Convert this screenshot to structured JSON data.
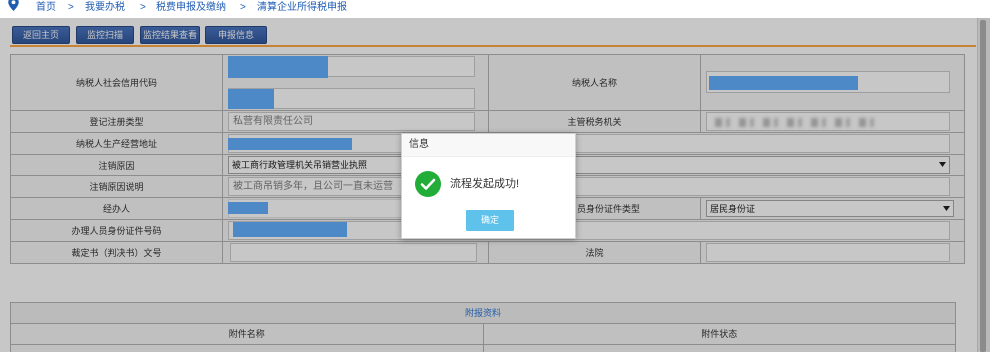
{
  "breadcrumb": {
    "separator": ">",
    "items": [
      "首页",
      "我要办税",
      "税费申报及缴纳",
      "清算企业所得税申报"
    ]
  },
  "toolbar": {
    "buttons": [
      "返回主页",
      "监控扫描",
      "监控结果查看",
      "申报信息"
    ]
  },
  "form": {
    "credit_code": {
      "label": "纳税人社会信用代码"
    },
    "taxpayer_name": {
      "label": "纳税人名称"
    },
    "registration_type": {
      "label": "登记注册类型",
      "value": "私营有限责任公司"
    },
    "tax_authority": {
      "label": "主管税务机关"
    },
    "business_address": {
      "label": "纳税人生产经营地址"
    },
    "cancel_reason": {
      "label": "注销原因",
      "selected": "被工商行政管理机关吊销营业执照"
    },
    "cancel_reason_note": {
      "label": "注销原因说明",
      "value": "被工商吊销多年，且公司一直未运营"
    },
    "handler": {
      "label": "经办人"
    },
    "handler_id_type": {
      "label": "员身份证件类型",
      "selected": "居民身份证"
    },
    "handler_id_number": {
      "label": "办理人员身份证件号码"
    },
    "ruling_number": {
      "label": "裁定书（判决书）文号"
    },
    "court": {
      "label": "法院"
    }
  },
  "attachments": {
    "title": "附报资料",
    "columns": [
      "附件名称",
      "附件状态"
    ]
  },
  "dialog": {
    "title": "信息",
    "message": "流程发起成功!",
    "confirm_label": "确定"
  },
  "icons": {
    "breadcrumb": "location-pin-icon",
    "dropdown": "dropdown-arrow-icon",
    "dialog": "success-check-icon"
  },
  "colors": {
    "link": "#1f5db3",
    "toolbar_button": "#3b65b0",
    "divider": "#ffa845",
    "redaction": "#63b0ff",
    "success": "#22ac38",
    "confirm_button": "#5ec2ea",
    "section_title": "#2f78d6"
  }
}
